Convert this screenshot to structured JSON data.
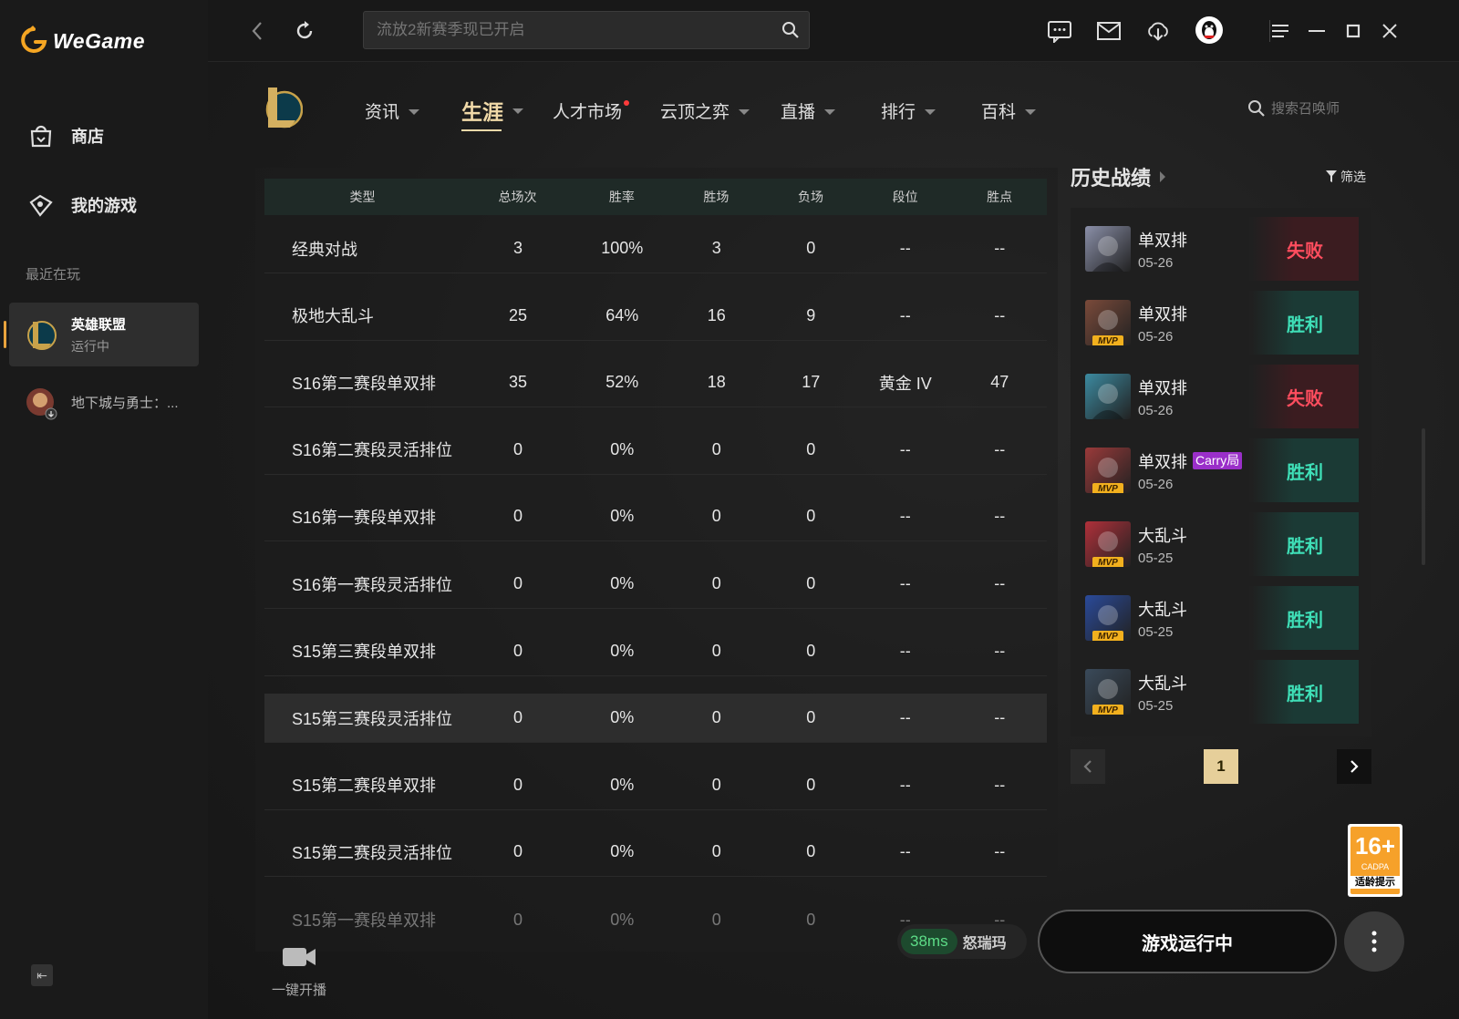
{
  "app": {
    "name": "WeGame"
  },
  "sidebar": {
    "nav": [
      {
        "label": "商店"
      },
      {
        "label": "我的游戏"
      }
    ],
    "recent_title": "最近在玩",
    "games": [
      {
        "name": "英雄联盟",
        "status": "运行中"
      },
      {
        "name": "地下城与勇士：..."
      }
    ]
  },
  "search": {
    "placeholder": "流放2新赛季现已开启"
  },
  "tabs": [
    {
      "label": "资讯"
    },
    {
      "label": "生涯"
    },
    {
      "label": "人才市场"
    },
    {
      "label": "云顶之弈"
    },
    {
      "label": "直播"
    },
    {
      "label": "排行"
    },
    {
      "label": "百科"
    }
  ],
  "summoner_search": {
    "placeholder": "搜索召唤师"
  },
  "table": {
    "headers": [
      "类型",
      "总场次",
      "胜率",
      "胜场",
      "负场",
      "段位",
      "胜点"
    ],
    "rows": [
      [
        "经典对战",
        "3",
        "100%",
        "3",
        "0",
        "--",
        "--"
      ],
      [
        "极地大乱斗",
        "25",
        "64%",
        "16",
        "9",
        "--",
        "--"
      ],
      [
        "S16第二赛段单双排",
        "35",
        "52%",
        "18",
        "17",
        "黄金 IV",
        "47"
      ],
      [
        "S16第二赛段灵活排位",
        "0",
        "0%",
        "0",
        "0",
        "--",
        "--"
      ],
      [
        "S16第一赛段单双排",
        "0",
        "0%",
        "0",
        "0",
        "--",
        "--"
      ],
      [
        "S16第一赛段灵活排位",
        "0",
        "0%",
        "0",
        "0",
        "--",
        "--"
      ],
      [
        "S15第三赛段单双排",
        "0",
        "0%",
        "0",
        "0",
        "--",
        "--"
      ],
      [
        "S15第三赛段灵活排位",
        "0",
        "0%",
        "0",
        "0",
        "--",
        "--"
      ],
      [
        "S15第二赛段单双排",
        "0",
        "0%",
        "0",
        "0",
        "--",
        "--"
      ],
      [
        "S15第二赛段灵活排位",
        "0",
        "0%",
        "0",
        "0",
        "--",
        "--"
      ],
      [
        "S15第一赛段单双排",
        "0",
        "0%",
        "0",
        "0",
        "--",
        "--"
      ]
    ]
  },
  "stream": {
    "label": "一键开播"
  },
  "history": {
    "title": "历史战绩",
    "filter": "筛选",
    "matches": [
      {
        "mode": "单双排",
        "date": "05-26",
        "result": "失败",
        "win": false,
        "mvp": false,
        "carry": "",
        "color": "#8a8fa8"
      },
      {
        "mode": "单双排",
        "date": "05-26",
        "result": "胜利",
        "win": true,
        "mvp": true,
        "mvp_label": "MVP",
        "carry": "",
        "color": "#7a4a3a"
      },
      {
        "mode": "单双排",
        "date": "05-26",
        "result": "失败",
        "win": false,
        "mvp": false,
        "carry": "",
        "color": "#3c8aa0"
      },
      {
        "mode": "单双排",
        "date": "05-26",
        "result": "胜利",
        "win": true,
        "mvp": true,
        "mvp_label": "MVP",
        "carry": "Carry局",
        "color": "#9a3a3a"
      },
      {
        "mode": "大乱斗",
        "date": "05-25",
        "result": "胜利",
        "win": true,
        "mvp": true,
        "mvp_label": "MVP",
        "carry": "",
        "color": "#b0303a"
      },
      {
        "mode": "大乱斗",
        "date": "05-25",
        "result": "胜利",
        "win": true,
        "mvp": true,
        "mvp_label": "MVP",
        "carry": "",
        "color": "#2a4a9a"
      },
      {
        "mode": "大乱斗",
        "date": "05-25",
        "result": "胜利",
        "win": true,
        "mvp": true,
        "mvp_label": "MVP",
        "carry": "",
        "color": "#3a4a5a"
      }
    ]
  },
  "pager": {
    "current": "1"
  },
  "age_rating": {
    "num": "16+",
    "org": "CADPA",
    "tip": "适龄提示"
  },
  "status": {
    "ping": "38ms",
    "server": "怒瑞玛",
    "run_label": "游戏运行中"
  }
}
